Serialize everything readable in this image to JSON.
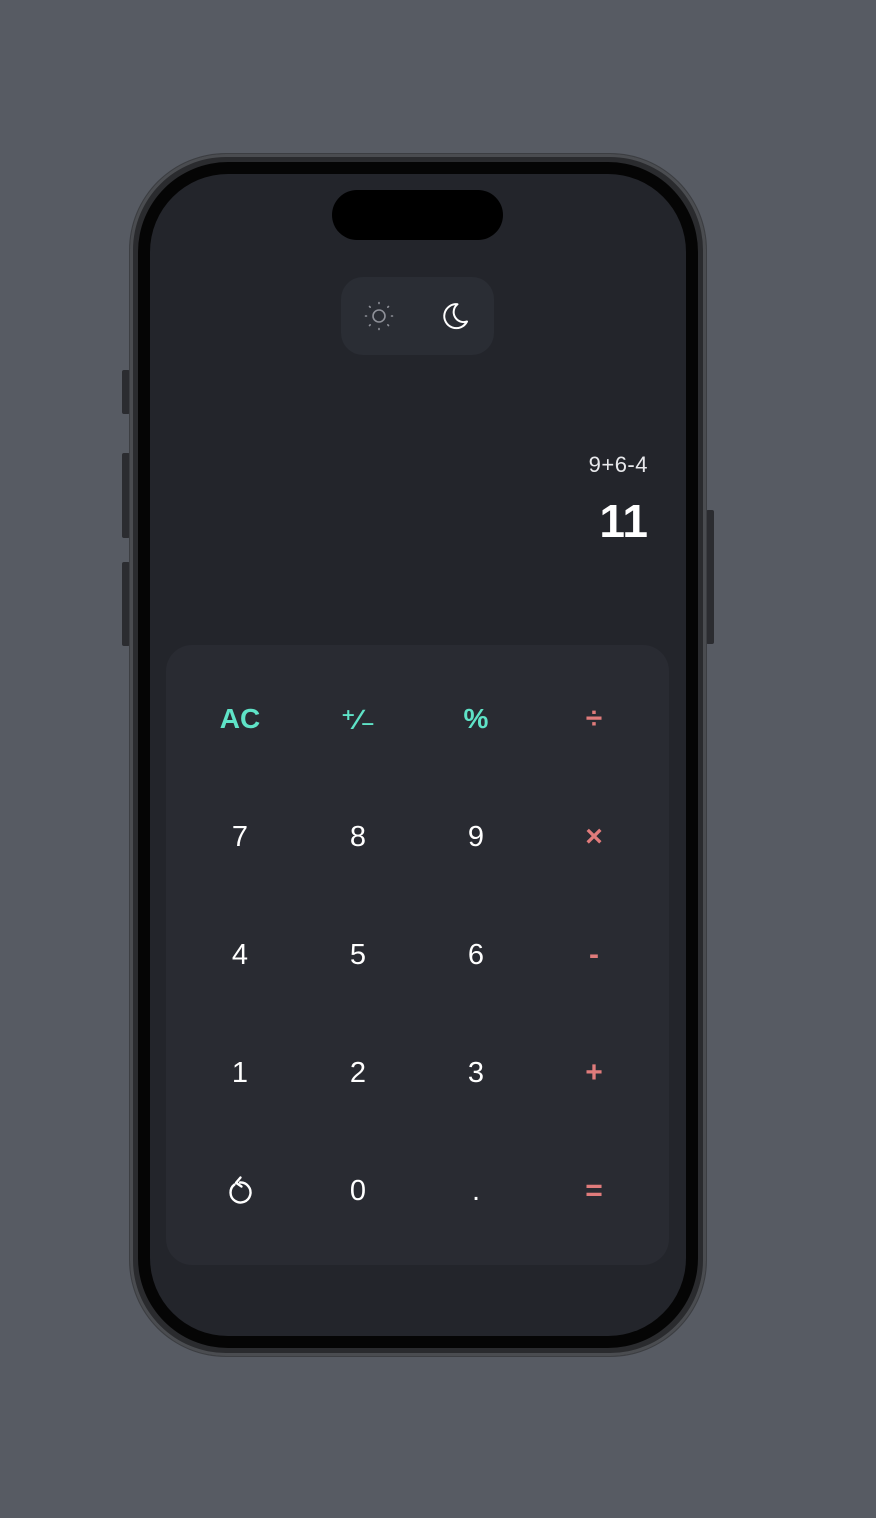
{
  "theme_toggle": {
    "light_icon": "sun-icon",
    "dark_icon": "moon-icon",
    "active": "dark"
  },
  "display": {
    "expression": "9+6-4",
    "result": "11"
  },
  "keys": {
    "row1": {
      "ac": "AC",
      "sign": "⁺∕₋",
      "percent": "%",
      "divide": "÷"
    },
    "row2": {
      "seven": "7",
      "eight": "8",
      "nine": "9",
      "multiply": "×"
    },
    "row3": {
      "four": "4",
      "five": "5",
      "six": "6",
      "minus": "-"
    },
    "row4": {
      "one": "1",
      "two": "2",
      "three": "3",
      "plus": "+"
    },
    "row5": {
      "undo_icon": "undo-icon",
      "zero": "0",
      "decimal": ".",
      "equals": "="
    }
  },
  "colors": {
    "background": "#575b63",
    "screen": "#23252b",
    "keypad": "#292b32",
    "function_accent": "#5fe3c7",
    "operator_accent": "#e07b7b",
    "text": "#ffffff"
  }
}
